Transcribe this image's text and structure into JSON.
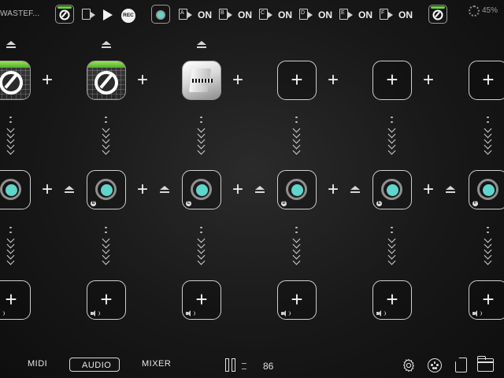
{
  "topbar": {
    "project_name": "WASTEF...",
    "rec_label": "REC",
    "scene_letters": [
      "A",
      "B",
      "C",
      "D",
      "E",
      "F"
    ],
    "scene_state": "ON",
    "battery_text": "45%"
  },
  "grid": {
    "columns": [
      "A",
      "B",
      "C",
      "D",
      "E",
      "F"
    ],
    "instrument_slots": [
      "moog-app",
      "moog-app",
      "piano-app",
      "empty",
      "empty",
      "empty"
    ],
    "fx_channel_badges": [
      "A",
      "B",
      "C",
      "D",
      "E",
      "F"
    ],
    "fx_ring_color": "#5fd5cc"
  },
  "bottombar": {
    "tab_midi": "MIDI",
    "tab_audio": "AUDIO",
    "tab_mixer": "MIXER",
    "active_tab": "AUDIO",
    "tempo": "86"
  },
  "colors": {
    "accent_green": "#6ccf3d",
    "accent_teal": "#5fd5cc",
    "background": "#1a1a1a"
  }
}
